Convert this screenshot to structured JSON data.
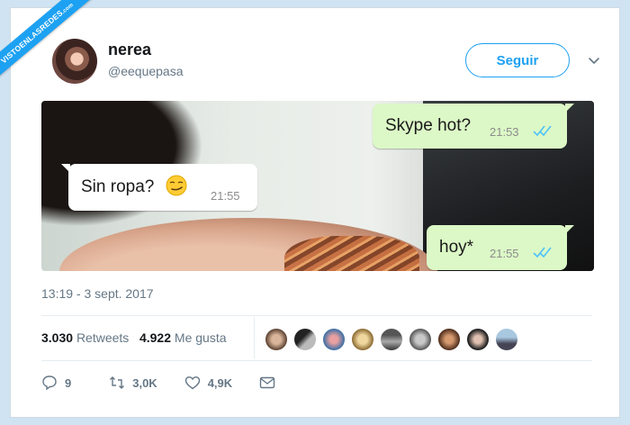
{
  "watermark": {
    "text": "VISTOENLASREDES",
    "suffix": ".com"
  },
  "tweet": {
    "user": {
      "name": "nerea",
      "handle": "@eequepasa"
    },
    "follow_label": "Seguir",
    "timestamp": "13:19 - 3 sept. 2017"
  },
  "chat": {
    "messages": [
      {
        "text": "Skype hot?",
        "time": "21:53",
        "direction": "out",
        "status": "read"
      },
      {
        "text": "Sin ropa?",
        "time": "21:55",
        "direction": "in",
        "emoji": "smirking-face"
      },
      {
        "text": "hoy*",
        "time": "21:55",
        "direction": "out",
        "status": "read"
      }
    ]
  },
  "stats": {
    "retweets_count": "3.030",
    "retweets_label": "Retweets",
    "likes_count": "4.922",
    "likes_label": "Me gusta"
  },
  "actions": {
    "replies": "9",
    "retweets": "3,0K",
    "likes": "4,9K"
  },
  "colors": {
    "accent": "#1da1f2",
    "bubble_out": "#dcf8c6",
    "bubble_in": "#ffffff",
    "read_ticks": "#4fc3f7"
  }
}
